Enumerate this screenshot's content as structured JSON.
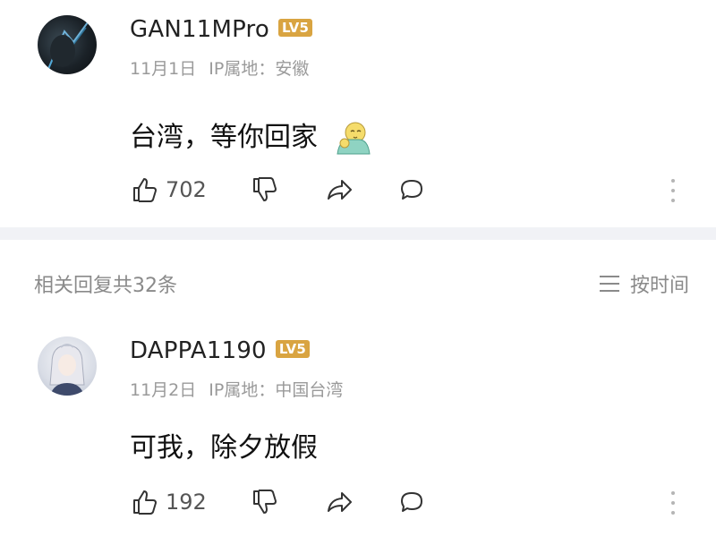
{
  "comments": [
    {
      "username": "GAN11MPro",
      "level": "LV5",
      "date": "11月1日",
      "ip": "IP属地：安徽",
      "text": "台湾，等你回家",
      "likes": "702"
    },
    {
      "username": "DAPPA1190",
      "level": "LV5",
      "date": "11月2日",
      "ip": "IP属地：中国台湾",
      "text": "可我，除夕放假",
      "likes": "192"
    }
  ],
  "replies": {
    "count_label": "相关回复共32条",
    "sort_label": "按时间"
  },
  "icons": {
    "like": "thumbs-up-icon",
    "dislike": "thumbs-down-icon",
    "share": "share-icon",
    "comment": "comment-bubble-icon",
    "more": "more-vertical-icon",
    "sort": "sort-lines-icon"
  },
  "colors": {
    "level_badge": "#d9a441",
    "meta_text": "#9a9a9a",
    "divider": "#f1f2f6"
  }
}
